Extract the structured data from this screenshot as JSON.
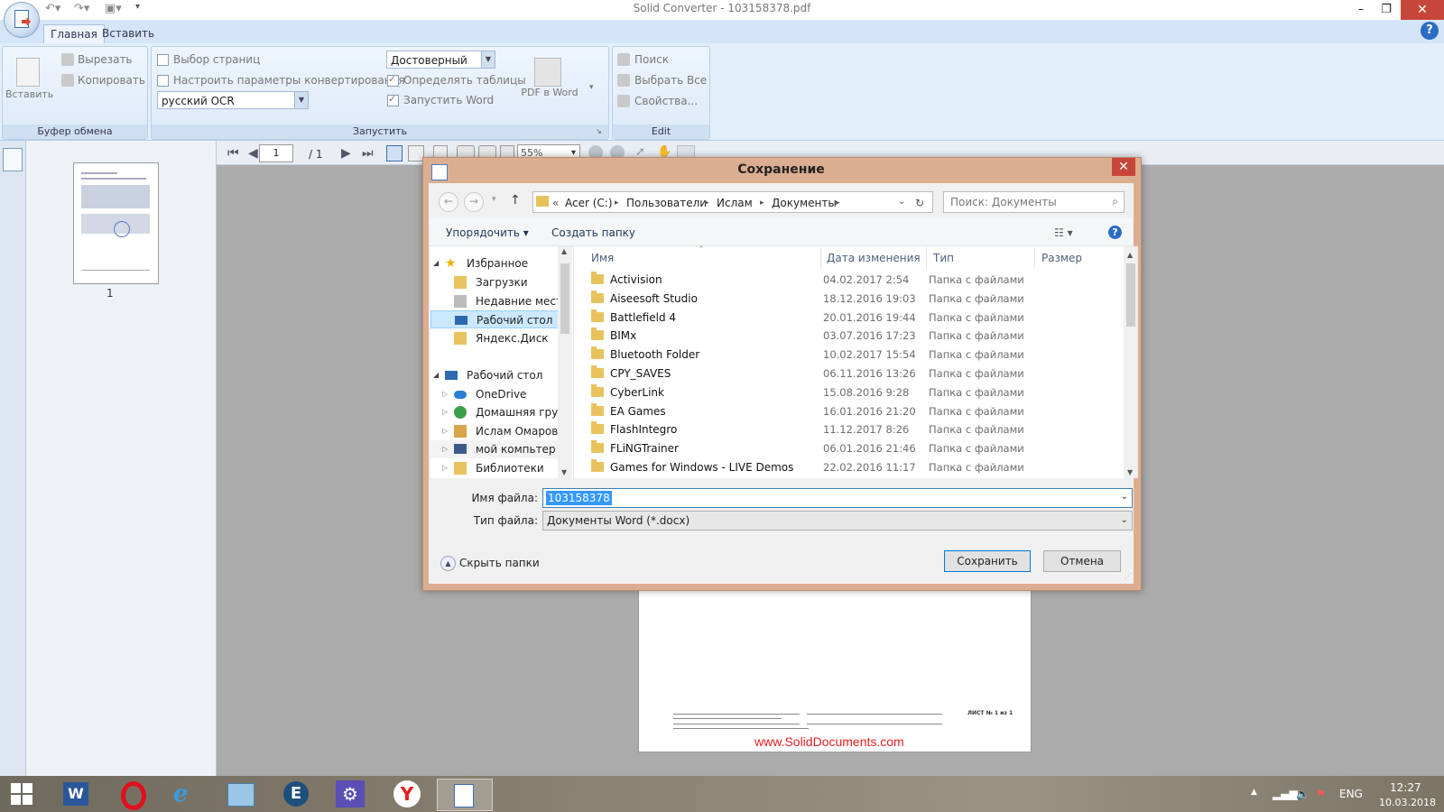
{
  "window": {
    "title": "Solid Converter - 103158378.pdf"
  },
  "ribbon": {
    "tabs": [
      {
        "label": "Главная"
      },
      {
        "label": "Вставить"
      }
    ],
    "clipboard": {
      "paste": "Вставить",
      "cut": "Вырезать",
      "copy": "Копировать",
      "group_label": "Буфер обмена"
    },
    "run": {
      "select_pages": "Выбор страниц",
      "conv_params": "Настроить параметры конвертирования",
      "ocr_value": "русский OCR",
      "mode_value": "Достоверный",
      "detect_tables": "Определять таблицы",
      "launch_word": "Запустить Word",
      "pdf_to_word": "PDF в Word",
      "group_label": "Запустить"
    },
    "edit": {
      "search": "Поиск",
      "select_all": "Выбрать Все",
      "properties": "Свойства...",
      "group_label": "Edit"
    }
  },
  "viewer": {
    "page_current": "1",
    "page_total": "/ 1",
    "zoom": "55%",
    "thumb_label": "1",
    "watermark": "www.SolidDocuments.com",
    "sheet": "ЛИСТ № 1 из 1"
  },
  "dialog": {
    "title": "Сохранение",
    "breadcrumbs": [
      "«",
      "Acer (C:)",
      "Пользователи",
      "Ислам",
      "Документы"
    ],
    "search_placeholder": "Поиск: Документы",
    "organize": "Упорядочить",
    "new_folder": "Создать папку",
    "tree": [
      {
        "label": "Избранное"
      },
      {
        "label": "Загрузки"
      },
      {
        "label": "Недавние места"
      },
      {
        "label": "Рабочий стол"
      },
      {
        "label": "Яндекс.Диск"
      },
      {
        "label": "Рабочий стол"
      },
      {
        "label": "OneDrive"
      },
      {
        "label": "Домашняя групп"
      },
      {
        "label": "Ислам Омаров"
      },
      {
        "label": "мой компьтер"
      },
      {
        "label": "Библиотеки"
      }
    ],
    "columns": {
      "name": "Имя",
      "date": "Дата изменения",
      "type": "Тип",
      "size": "Размер"
    },
    "files": [
      {
        "name": "Activision",
        "date": "04.02.2017 2:54",
        "type": "Папка с файлами"
      },
      {
        "name": "Aiseesoft Studio",
        "date": "18.12.2016 19:03",
        "type": "Папка с файлами"
      },
      {
        "name": "Battlefield 4",
        "date": "20.01.2016 19:44",
        "type": "Папка с файлами"
      },
      {
        "name": "BIMx",
        "date": "03.07.2016 17:23",
        "type": "Папка с файлами"
      },
      {
        "name": "Bluetooth Folder",
        "date": "10.02.2017 15:54",
        "type": "Папка с файлами"
      },
      {
        "name": "CPY_SAVES",
        "date": "06.11.2016 13:26",
        "type": "Папка с файлами"
      },
      {
        "name": "CyberLink",
        "date": "15.08.2016 9:28",
        "type": "Папка с файлами"
      },
      {
        "name": "EA Games",
        "date": "16.01.2016 21:20",
        "type": "Папка с файлами"
      },
      {
        "name": "FlashIntegro",
        "date": "11.12.2017 8:26",
        "type": "Папка с файлами"
      },
      {
        "name": "FLiNGTrainer",
        "date": "06.01.2016 21:46",
        "type": "Папка с файлами"
      },
      {
        "name": "Games for Windows - LIVE Demos",
        "date": "22.02.2016 11:17",
        "type": "Папка с файлами"
      }
    ],
    "filename_label": "Имя файла:",
    "filename_value": "103158378",
    "filetype_label": "Тип файла:",
    "filetype_value": "Документы Word (*.docx)",
    "hide_folders": "Скрыть папки",
    "save": "Сохранить",
    "cancel": "Отмена"
  },
  "taskbar": {
    "lang": "ENG",
    "time": "12:27",
    "date": "10.03.2018"
  }
}
